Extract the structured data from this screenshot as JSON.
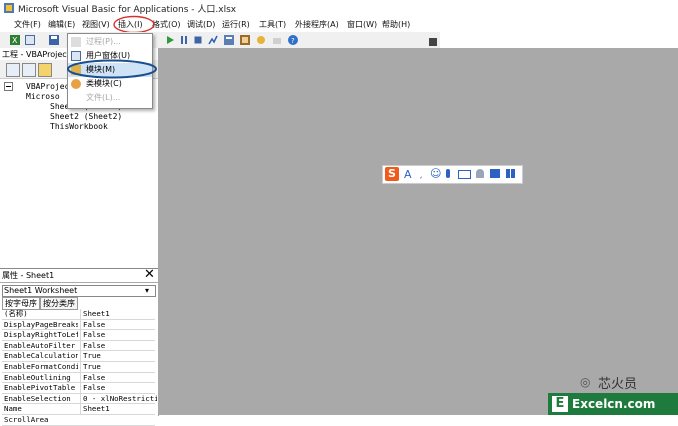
{
  "window": {
    "title": "Microsoft Visual Basic for Applications - 人口.xlsx"
  },
  "menubar": {
    "items": [
      "文件(F)",
      "编辑(E)",
      "视图(V)",
      "插入(I)",
      "格式(O)",
      "调试(D)",
      "运行(R)",
      "工具(T)",
      "外接程序(A)",
      "窗口(W)",
      "帮助(H)"
    ]
  },
  "insert_menu": {
    "items": [
      {
        "label": "过程(P)...",
        "enabled": false
      },
      {
        "label": "用户窗体(U)",
        "enabled": true
      },
      {
        "label": "模块(M)",
        "enabled": true,
        "highlighted": true
      },
      {
        "label": "类模块(C)",
        "enabled": true
      },
      {
        "label": "文件(L)...",
        "enabled": false
      }
    ]
  },
  "project_panel": {
    "title": "工程 - VBAProject",
    "tree": {
      "root": "VBAProjec",
      "folder": "Microso",
      "items": [
        "Sheet1 (Sheet1)",
        "Sheet2 (Sheet2)",
        "ThisWorkbook"
      ]
    }
  },
  "properties_panel": {
    "title": "属性 - Sheet1",
    "object_select": "Sheet1 Worksheet",
    "tabs": [
      "按字母序",
      "按分类序"
    ],
    "rows": [
      {
        "key": "(名称)",
        "value": "Sheet1"
      },
      {
        "key": "DisplayPageBreaks",
        "value": "False"
      },
      {
        "key": "DisplayRightToLef",
        "value": "False"
      },
      {
        "key": "EnableAutoFilter",
        "value": "False"
      },
      {
        "key": "EnableCalculation",
        "value": "True"
      },
      {
        "key": "EnableFormatCondi",
        "value": "True"
      },
      {
        "key": "EnableOutlining",
        "value": "False"
      },
      {
        "key": "EnablePivotTable",
        "value": "False"
      },
      {
        "key": "EnableSelection",
        "value": "0 - xlNoRestricti"
      },
      {
        "key": "Name",
        "value": "Sheet1"
      },
      {
        "key": "ScrollArea",
        "value": ""
      }
    ]
  },
  "ime_bar": {
    "brand_letter": "S",
    "label": "A"
  },
  "watermark": {
    "brand": "芯火员",
    "site": "Excelcn.com"
  },
  "colors": {
    "workspace": "#a9a9a9",
    "highlight_circle": "#1a4e8c",
    "insert_circle": "#d6312c",
    "ime_orange": "#f05a1a",
    "logo_green": "#1f7a3d"
  }
}
